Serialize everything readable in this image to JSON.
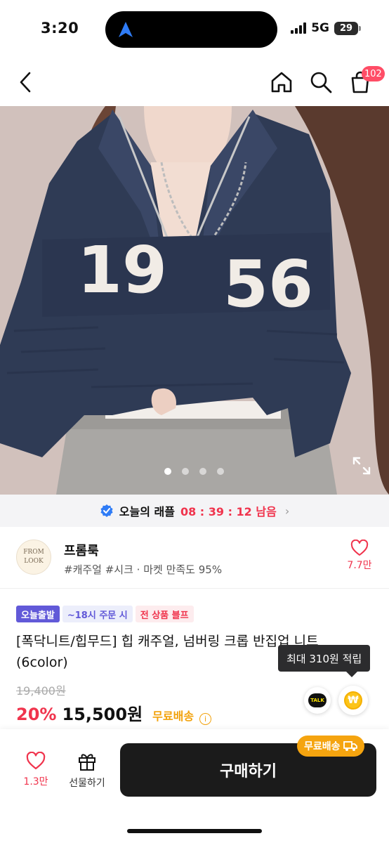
{
  "status_bar": {
    "time": "3:20",
    "network": "5G",
    "battery": "29"
  },
  "header": {
    "icons": {
      "back": "chevron-left-icon",
      "home": "home-icon",
      "search": "search-icon",
      "cart": "shopping-bag-icon"
    },
    "cart_count": "102"
  },
  "hero": {
    "page_count": 4,
    "active_page": 1,
    "expand_icon": "expand-icon"
  },
  "raffle": {
    "title": "오늘의 래플",
    "timer": "08 : 39 : 12 남음",
    "icon": "verified-badge-icon"
  },
  "brand": {
    "logo_line1": "FROM",
    "logo_line2": "LOOK",
    "name": "프롬룩",
    "tags": "#캐주얼 #시크 · 마켓 만족도 95%",
    "like_count": "7.7만"
  },
  "product": {
    "chips": {
      "today": "오늘출발",
      "cutoff": "~18시 주문 시",
      "sale": "전 상품 블프"
    },
    "title": "[폭닥니트/힙무드] 힙 캐주얼, 넘버링 크롭 반집업 니트(6color)",
    "points_tooltip": "최대 310원 적립",
    "original_price": "19,400원",
    "discount": "20%",
    "price": "15,500원",
    "free_shipping": "무료배송",
    "talk_label": "TALK",
    "coin_symbol": "₩"
  },
  "bottom_bar": {
    "like_count": "1.3만",
    "gift_label": "선물하기",
    "buy_label": "구매하기",
    "ship_badge": "무료배송"
  },
  "colors": {
    "accent_red": "#f0344d",
    "accent_purple": "#6159d8",
    "shipping_orange": "#f5a40f",
    "sweater_navy": "#2f3b55",
    "buy_button": "#1b1b1b"
  }
}
